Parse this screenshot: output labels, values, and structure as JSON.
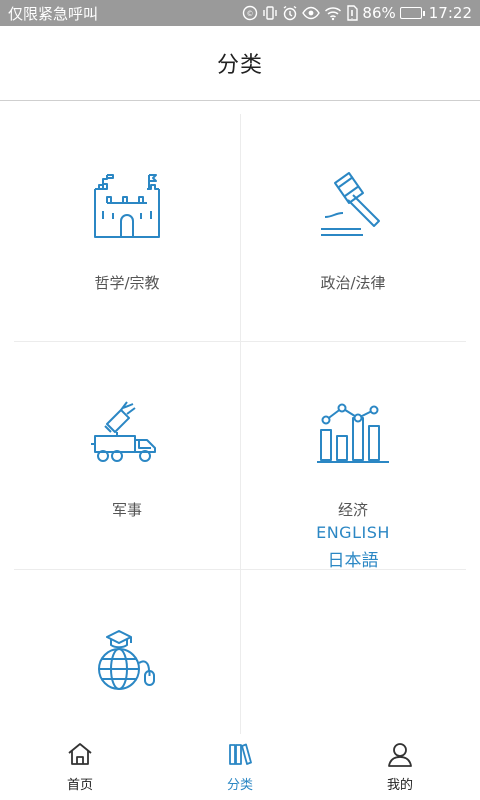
{
  "status_bar": {
    "carrier_text": "仅限紧急呼叫",
    "battery_percent": "86%",
    "battery_level": 0.86,
    "time": "17:22"
  },
  "header": {
    "title": "分类"
  },
  "categories": [
    {
      "label": "哲学/宗教",
      "icon": "castle-icon"
    },
    {
      "label": "政治/法律",
      "icon": "gavel-icon"
    },
    {
      "label": "军事",
      "icon": "missile-truck-icon"
    },
    {
      "label": "经济",
      "icon": "bar-chart-icon"
    },
    {
      "label": "",
      "icon": "globe-graduation-icon"
    },
    {
      "label_en": "ENGLISH",
      "label_jp": "日本語"
    }
  ],
  "tabbar": {
    "items": [
      {
        "label": "首页",
        "icon": "home-icon",
        "active": false
      },
      {
        "label": "分类",
        "icon": "books-icon",
        "active": true
      },
      {
        "label": "我的",
        "icon": "user-icon",
        "active": false
      }
    ]
  },
  "colors": {
    "accent": "#2b87c4",
    "status_bar": "#9a9a9a",
    "battery": "#3fd36a"
  }
}
